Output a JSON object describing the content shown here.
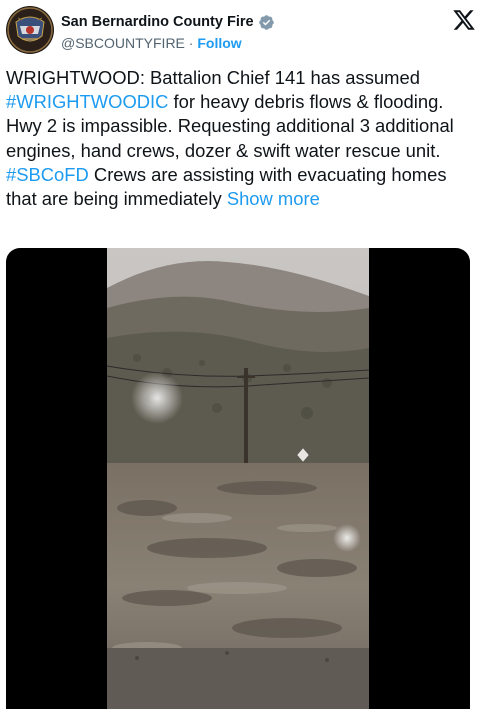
{
  "author": {
    "name": "San Bernardino County Fire",
    "handle": "@SBCOUNTYFIRE",
    "separator": "·",
    "follow_label": "Follow",
    "verified_icon": "verified-badge-icon",
    "avatar_icon": "sbcofd-patch-logo"
  },
  "platform_icon": "x-logo-icon",
  "tweet": {
    "prefix": "WRIGHTWOOD: Battalion Chief 141 has assumed ",
    "hashtag1": "#WRIGHTWOODIC",
    "mid": " for heavy debris flows & flooding. Hwy 2 is impassible. Requesting additional 3 additional engines, hand crews, dozer & swift water rescue unit. ",
    "hashtag2": "#SBCoFD",
    "suffix": " Crews are assisting with evacuating homes that are being immediately ",
    "show_more": "Show more"
  },
  "media": {
    "type": "video",
    "description_icon": "video-frame"
  },
  "colors": {
    "link": "#1d9bf0",
    "text": "#0f1419",
    "muted": "#536471",
    "verified": "#829aab"
  }
}
